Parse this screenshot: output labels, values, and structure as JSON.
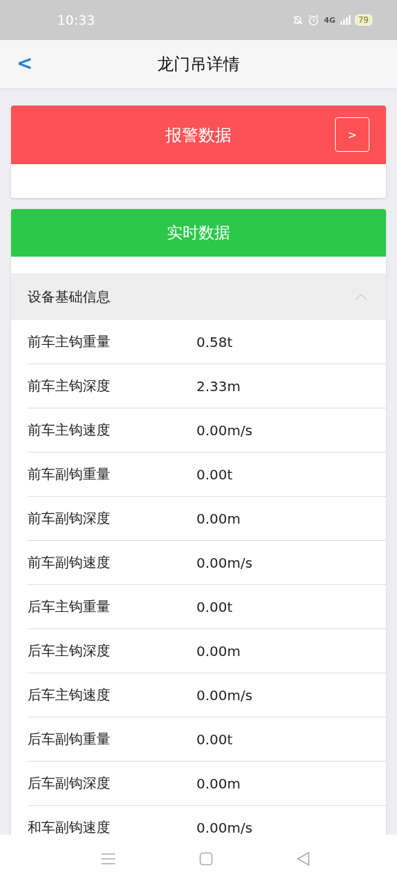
{
  "status_bar": {
    "time": "10:33",
    "network": "4G",
    "battery": "79"
  },
  "header": {
    "title": "龙门吊详情",
    "back": "<"
  },
  "alarm_card": {
    "title": "报警数据",
    "button": ">"
  },
  "realtime_card": {
    "title": "实时数据",
    "section": {
      "title": "设备基础信息",
      "expanded": true,
      "rows": [
        {
          "label": "前车主钩重量",
          "value": "0.58t"
        },
        {
          "label": "前车主钩深度",
          "value": "2.33m"
        },
        {
          "label": "前车主钩速度",
          "value": "0.00m/s"
        },
        {
          "label": "前车副钩重量",
          "value": "0.00t"
        },
        {
          "label": "前车副钩深度",
          "value": "0.00m"
        },
        {
          "label": "前车副钩速度",
          "value": "0.00m/s"
        },
        {
          "label": "后车主钩重量",
          "value": "0.00t"
        },
        {
          "label": "后车主钩深度",
          "value": "0.00m"
        },
        {
          "label": "后车主钩速度",
          "value": "0.00m/s"
        },
        {
          "label": "后车副钩重量",
          "value": "0.00t"
        },
        {
          "label": "后车副钩深度",
          "value": "0.00m"
        },
        {
          "label": "和车副钩速度",
          "value": "0.00m/s"
        }
      ]
    }
  }
}
